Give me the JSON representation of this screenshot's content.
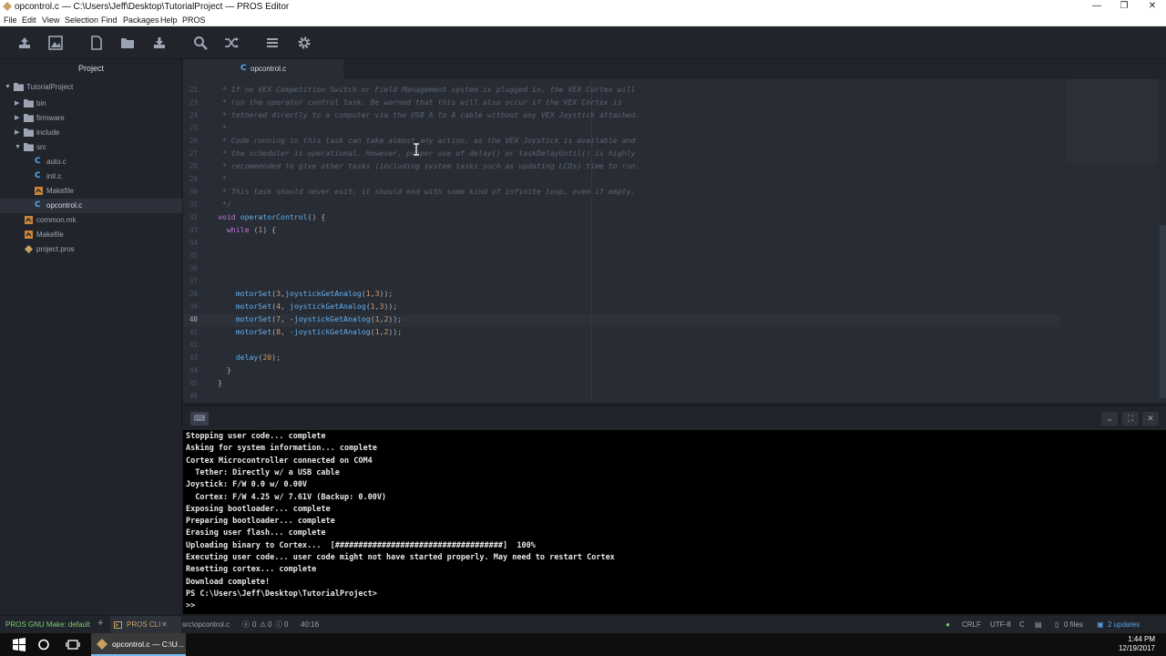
{
  "window": {
    "title": "opcontrol.c — C:\\Users\\Jeff\\Desktop\\TutorialProject — PROS Editor",
    "minimize_glyph": "—",
    "maximize_glyph": "❐",
    "close_glyph": "✕"
  },
  "menubar": {
    "items": [
      "File",
      "Edit",
      "View",
      "Selection",
      "Find",
      "Packages",
      "Help",
      "PROS"
    ]
  },
  "toolbar": {
    "tools": [
      "upload-icon",
      "build-upload-icon",
      "new-file-icon",
      "open-folder-icon",
      "download-icon",
      "search-icon",
      "shuffle-icon",
      "menu-icon",
      "settings-icon"
    ]
  },
  "sidebar": {
    "title": "Project",
    "items": [
      {
        "label": "TutorialProject",
        "type": "root-folder",
        "expanded": true
      },
      {
        "label": "bin",
        "type": "folder",
        "expanded": false
      },
      {
        "label": "firmware",
        "type": "folder",
        "expanded": false
      },
      {
        "label": "include",
        "type": "folder",
        "expanded": false
      },
      {
        "label": "src",
        "type": "folder",
        "expanded": true
      },
      {
        "label": "auto.c",
        "type": "c-file"
      },
      {
        "label": "init.c",
        "type": "c-file"
      },
      {
        "label": "Makefile",
        "type": "makefile"
      },
      {
        "label": "opcontrol.c",
        "type": "c-file",
        "selected": true
      },
      {
        "label": "common.mk",
        "type": "makefile"
      },
      {
        "label": "Makefile",
        "type": "makefile"
      },
      {
        "label": "project.pros",
        "type": "pros-file"
      }
    ]
  },
  "tabs": [
    {
      "label": "opcontrol.c",
      "icon": "c-file-icon",
      "active": true
    }
  ],
  "editor": {
    "current_line": "40",
    "lines": [
      {
        "n": "22",
        "text": " * If no VEX Competition Switch or Field Management system is plugged in, the VEX Cortex will",
        "kind": "comment"
      },
      {
        "n": "23",
        "text": " * run the operator control task. Be warned that this will also occur if the VEX Cortex is",
        "kind": "comment"
      },
      {
        "n": "24",
        "text": " * tethered directly to a computer via the USB A to A cable without any VEX Joystick attached.",
        "kind": "comment"
      },
      {
        "n": "25",
        "text": " *",
        "kind": "comment"
      },
      {
        "n": "26",
        "text": " * Code running in this task can take almost any action, as the VEX Joystick is available and",
        "kind": "comment"
      },
      {
        "n": "27",
        "text": " * the scheduler is operational. However, proper use of delay() or taskDelayUntil() is highly",
        "kind": "comment"
      },
      {
        "n": "28",
        "text": " * recommended to give other tasks (including system tasks such as updating LCDs) time to run.",
        "kind": "comment"
      },
      {
        "n": "29",
        "text": " *",
        "kind": "comment"
      },
      {
        "n": "30",
        "text": " * This task should never exit; it should end with some kind of infinite loop, even if empty.",
        "kind": "comment"
      },
      {
        "n": "31",
        "text": " */",
        "kind": "comment"
      },
      {
        "n": "32",
        "text": "void operatorControl() {",
        "kind": "code"
      },
      {
        "n": "33",
        "text": "  while (1) {",
        "kind": "code"
      },
      {
        "n": "34",
        "text": "",
        "kind": "code"
      },
      {
        "n": "35",
        "text": "",
        "kind": "code"
      },
      {
        "n": "36",
        "text": "",
        "kind": "code"
      },
      {
        "n": "37",
        "text": "",
        "kind": "code"
      },
      {
        "n": "38",
        "text": "    motorSet(3,joystickGetAnalog(1,3));",
        "kind": "code"
      },
      {
        "n": "39",
        "text": "    motorSet(4, joystickGetAnalog(1,3));",
        "kind": "code"
      },
      {
        "n": "40",
        "text": "    motorSet(7, -joystickGetAnalog(1,2));",
        "kind": "code"
      },
      {
        "n": "41",
        "text": "    motorSet(8, -joystickGetAnalog(1,2));",
        "kind": "code"
      },
      {
        "n": "42",
        "text": "",
        "kind": "code"
      },
      {
        "n": "43",
        "text": "    delay(20);",
        "kind": "code"
      },
      {
        "n": "44",
        "text": "  }",
        "kind": "code"
      },
      {
        "n": "45",
        "text": "}",
        "kind": "code"
      },
      {
        "n": "46",
        "text": "",
        "kind": "code"
      }
    ]
  },
  "terminal": {
    "lines": [
      "Stopping user code... complete",
      "Asking for system information... complete",
      "Cortex Microcontroller connected on COM4",
      "  Tether: Directly w/ a USB cable",
      "Joystick: F/W 0.0 w/ 0.00V",
      "  Cortex: F/W 4.25 w/ 7.61V (Backup: 0.00V)",
      "Exposing bootloader... complete",
      "Preparing bootloader... complete",
      "Erasing user flash... complete",
      "Uploading binary to Cortex...  [####################################]  100%",
      "Executing user code... user code might not have started properly. May need to restart Cortex",
      "Resetting cortex... complete",
      "Download complete!",
      "PS C:\\Users\\Jeff\\Desktop\\TutorialProject>",
      ">>"
    ],
    "upload_progress": 1.0
  },
  "statusbar": {
    "make_target": "PROS GNU Make: default",
    "add_glyph": "+",
    "cli_tab": "PROS CLI",
    "close_glyph": "✕",
    "file_path": "src\\opcontrol.c",
    "errors": "0",
    "warnings": "0",
    "infos": "0",
    "cursor": "40:16",
    "line_ending": "CRLF",
    "encoding": "UTF-8",
    "grammar": "C",
    "files": "0 files",
    "updates": "2 updates"
  },
  "taskbar": {
    "app_label": "opcontrol.c — C:\\U...",
    "time": "1:44 PM",
    "date": "12/19/2017"
  },
  "colors": {
    "accent": "#5aa0e6",
    "status_ok": "#7bc96f",
    "editor_bg": "#282c34",
    "sidebar_bg": "#21252b"
  }
}
